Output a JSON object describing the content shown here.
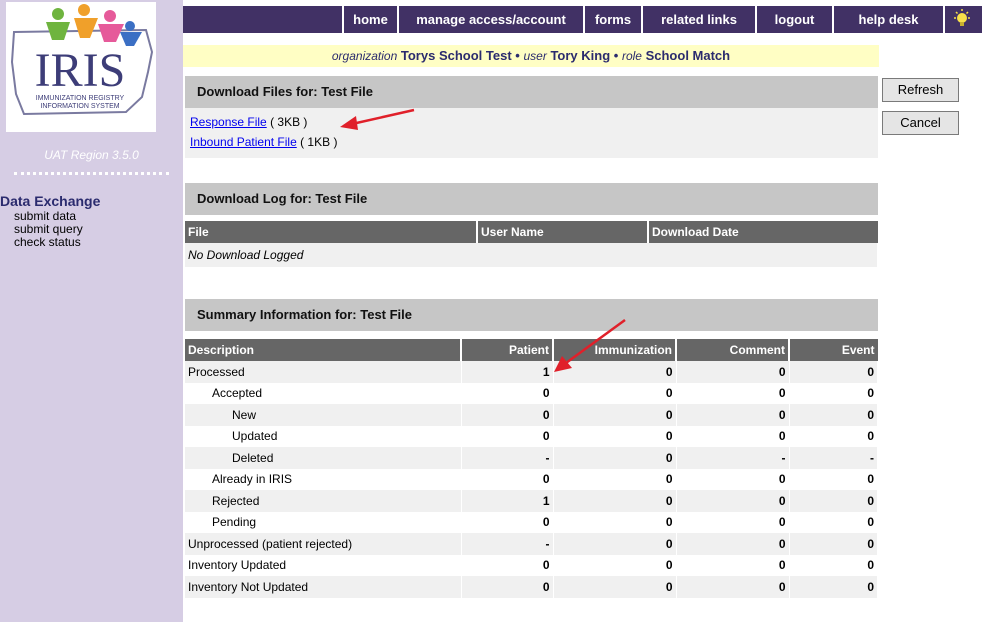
{
  "sidebar": {
    "logo_text": "IRIS",
    "logo_sub1": "IMMUNIZATION REGISTRY",
    "logo_sub2": "INFORMATION SYSTEM",
    "region": "UAT Region 3.5.0",
    "section_title": "Data Exchange",
    "links": [
      "submit data",
      "submit query",
      "check status"
    ]
  },
  "nav": {
    "items": [
      "home",
      "manage access/account",
      "forms",
      "related links",
      "logout",
      "help desk"
    ]
  },
  "info": {
    "org_label": "organization",
    "org_value": "Torys School Test",
    "user_label": "user",
    "user_value": "Tory King",
    "role_label": "role",
    "role_value": "School Match",
    "separator": "•"
  },
  "download_files": {
    "title": "Download Files for: Test File",
    "files": [
      {
        "name": "Response File",
        "size": "( 3KB )"
      },
      {
        "name": "Inbound Patient File",
        "size": "( 1KB )"
      }
    ]
  },
  "download_log": {
    "title": "Download Log for: Test File",
    "columns": [
      "File",
      "User Name",
      "Download Date"
    ],
    "empty": "No Download Logged"
  },
  "summary": {
    "title": "Summary Information for: Test File",
    "columns": [
      "Description",
      "Patient",
      "Immunization",
      "Comment",
      "Event"
    ],
    "rows": [
      {
        "label": "Processed",
        "values": [
          "1",
          "0",
          "0",
          "0"
        ]
      },
      {
        "label": "Accepted",
        "values": [
          "0",
          "0",
          "0",
          "0"
        ]
      },
      {
        "label": "New",
        "values": [
          "0",
          "0",
          "0",
          "0"
        ]
      },
      {
        "label": "Updated",
        "values": [
          "0",
          "0",
          "0",
          "0"
        ]
      },
      {
        "label": "Deleted",
        "values": [
          "-",
          "0",
          "-",
          "-"
        ]
      },
      {
        "label": "Already in IRIS",
        "values": [
          "0",
          "0",
          "0",
          "0"
        ]
      },
      {
        "label": "Rejected",
        "values": [
          "1",
          "0",
          "0",
          "0"
        ]
      },
      {
        "label": "Pending",
        "values": [
          "0",
          "0",
          "0",
          "0"
        ]
      },
      {
        "label": "Unprocessed (patient rejected)",
        "values": [
          "-",
          "0",
          "0",
          "0"
        ]
      },
      {
        "label": "Inventory Updated",
        "values": [
          "0",
          "0",
          "0",
          "0"
        ]
      },
      {
        "label": "Inventory Not Updated",
        "values": [
          "0",
          "0",
          "0",
          "0"
        ]
      }
    ]
  },
  "buttons": {
    "refresh": "Refresh",
    "cancel": "Cancel"
  },
  "colors": {
    "nav_bg": "#413165",
    "sidebar_bg": "#d6cde4",
    "info_bg": "#fffec4",
    "annotation_arrow": "#e0202a"
  }
}
